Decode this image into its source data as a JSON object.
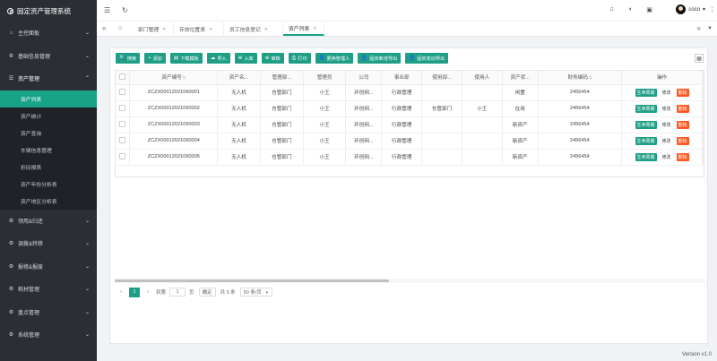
{
  "app": {
    "title": "固定资产管理系统"
  },
  "sidebar": {
    "items": [
      {
        "label": "主控面板",
        "icon": "home-icon"
      },
      {
        "label": "基础信息管理",
        "icon": "gear-icon"
      },
      {
        "label": "资产管理",
        "icon": "asset-icon",
        "open": true,
        "children": [
          "资产列表",
          "资产统计",
          "资产查询",
          "车辆信息管理",
          "折旧报表",
          "资产年份分析表",
          "资产地区分析表"
        ]
      },
      {
        "label": "领用&归还",
        "icon": "gear-icon"
      },
      {
        "label": "调拨&转移",
        "icon": "gear-icon"
      },
      {
        "label": "报修&报废",
        "icon": "gear-icon"
      },
      {
        "label": "耗材管理",
        "icon": "gear-icon"
      },
      {
        "label": "盘点管理",
        "icon": "gear-icon"
      },
      {
        "label": "系统管理",
        "icon": "gear-icon"
      }
    ],
    "active_child": "资产列表"
  },
  "topbar": {
    "user": "coco"
  },
  "tabs": [
    {
      "label": "部门管理"
    },
    {
      "label": "存放位置表"
    },
    {
      "label": "员工信息登记"
    },
    {
      "label": "资产列表",
      "active": true
    }
  ],
  "toolbar": {
    "buttons": [
      "搜索",
      "添加",
      "下载模板",
      "导入",
      "入库",
      "审核",
      "打印",
      "更换管理人",
      "固资新增导出",
      "固资变动导出"
    ]
  },
  "table": {
    "columns": [
      "资产编号",
      "资产名...",
      "管理部...",
      "管理员",
      "公司",
      "事业部",
      "使用部...",
      "使用人",
      "资产状...",
      "财务编码",
      "操作"
    ],
    "rows": [
      {
        "code": "ZCZX00012021090001",
        "name": "无人机",
        "mgr_dept": "仓管部门",
        "admin": "小王",
        "company": "环创网...",
        "bu": "行政管理",
        "use_dept": "",
        "user": "",
        "status": "闲置",
        "fin": "2456454"
      },
      {
        "code": "ZCZX00012021090002",
        "name": "无人机",
        "mgr_dept": "仓管部门",
        "admin": "小王",
        "company": "环创网...",
        "bu": "行政管理",
        "use_dept": "仓管部门",
        "user": "小王",
        "status": "在用",
        "fin": "2456454"
      },
      {
        "code": "ZCZX00012021090003",
        "name": "无人机",
        "mgr_dept": "仓管部门",
        "admin": "小王",
        "company": "环创网...",
        "bu": "行政管理",
        "use_dept": "",
        "user": "",
        "status": "新资产",
        "fin": "2456454"
      },
      {
        "code": "ZCZX00012021090004",
        "name": "无人机",
        "mgr_dept": "仓管部门",
        "admin": "小王",
        "company": "环创网...",
        "bu": "行政管理",
        "use_dept": "",
        "user": "",
        "status": "新资产",
        "fin": "2456454"
      },
      {
        "code": "ZCZX00012021090005",
        "name": "无人机",
        "mgr_dept": "仓管部门",
        "admin": "小王",
        "company": "环创网...",
        "bu": "行政管理",
        "use_dept": "",
        "user": "",
        "status": "新资产",
        "fin": "2456454"
      }
    ],
    "actions": {
      "life": "生命周期",
      "edit": "修改",
      "del": "删除"
    }
  },
  "pager": {
    "current": "1",
    "goto_label": "到第",
    "goto_value": "1",
    "page_unit": "页",
    "confirm": "确定",
    "total": "共 5 条",
    "page_size": "50 条/页"
  },
  "footer": {
    "version": "Version v1.0"
  },
  "colors": {
    "accent": "#1e9e85",
    "danger": "#ff5722",
    "sidebar": "#2b2f35"
  }
}
